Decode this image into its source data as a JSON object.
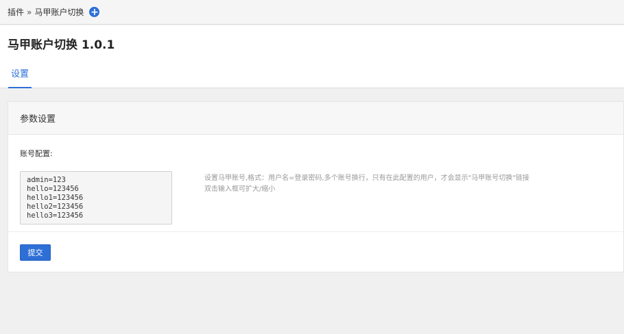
{
  "breadcrumb": {
    "root": "插件",
    "separator": "»",
    "current": "马甲账户切换"
  },
  "header": {
    "title": "马甲账户切换 1.0.1",
    "tabs": [
      {
        "label": "设置"
      }
    ]
  },
  "panel": {
    "title": "参数设置",
    "field_label": "账号配置:",
    "textarea_value": "admin=123\nhello=123456\nhello1=123456\nhello2=123456\nhello3=123456",
    "hint_line1": "设置马甲账号,格式：用户名=登录密码,多个账号换行，只有在此配置的用户，才会显示\"马甲账号切换\"链接",
    "hint_line2": "双击输入框可扩大/缩小",
    "submit_label": "提交"
  },
  "icons": {
    "add": "plus-circle-icon"
  },
  "colors": {
    "accent": "#2e6fd6"
  }
}
